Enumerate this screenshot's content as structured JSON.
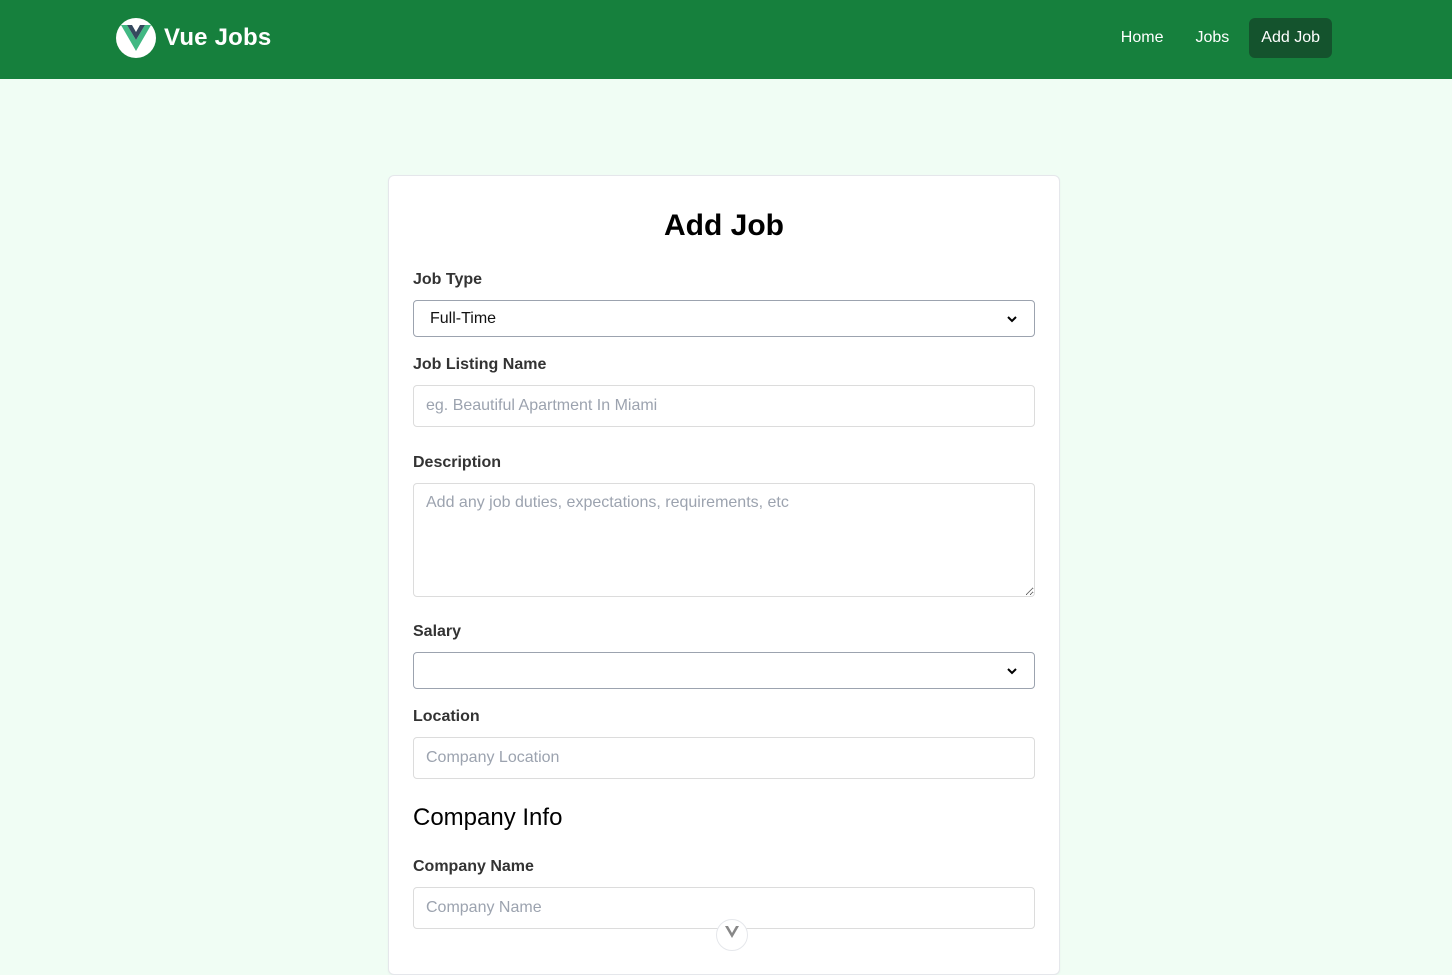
{
  "nav": {
    "brand": "Vue Jobs",
    "links": [
      {
        "label": "Home"
      },
      {
        "label": "Jobs"
      },
      {
        "label": "Add Job"
      }
    ]
  },
  "form": {
    "title": "Add Job",
    "job_type": {
      "label": "Job Type",
      "value": "Full-Time"
    },
    "listing_name": {
      "label": "Job Listing Name",
      "placeholder": "eg. Beautiful Apartment In Miami"
    },
    "description": {
      "label": "Description",
      "placeholder": "Add any job duties, expectations, requirements, etc"
    },
    "salary": {
      "label": "Salary",
      "value": ""
    },
    "location": {
      "label": "Location",
      "placeholder": "Company Location"
    },
    "company_section": "Company Info",
    "company_name": {
      "label": "Company Name",
      "placeholder": "Company Name"
    }
  },
  "colors": {
    "nav_bg": "#16803d",
    "active_link_bg": "#14532d",
    "page_bg": "#f0fdf4"
  }
}
